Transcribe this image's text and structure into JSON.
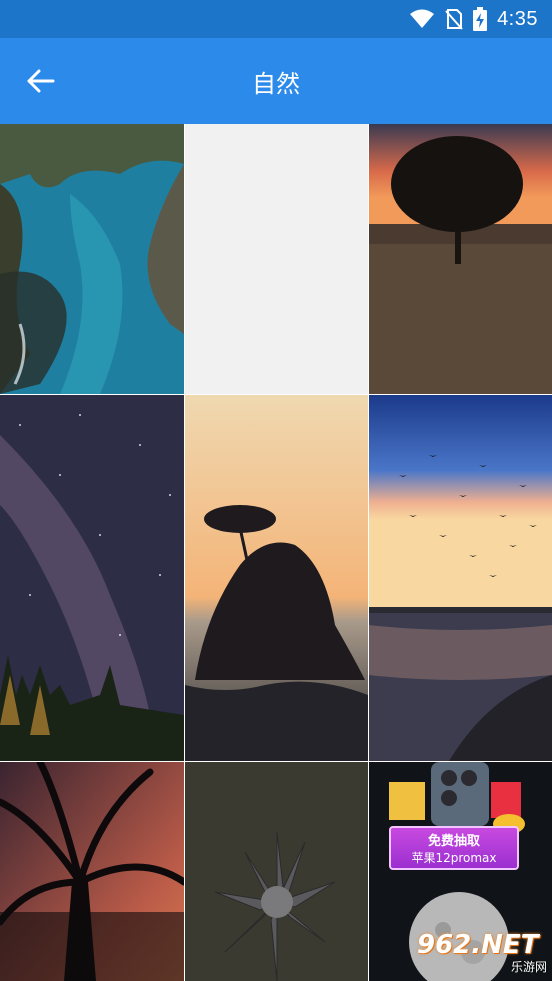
{
  "status_bar": {
    "time": "4:35",
    "icons": [
      "wifi-icon",
      "no-sim-icon",
      "battery-charging-icon"
    ]
  },
  "app_bar": {
    "title": "自然",
    "back_icon": "arrow-left-icon"
  },
  "wallpapers": [
    {
      "id": 1,
      "subject": "turquoise-river-canyon"
    },
    {
      "id": 2,
      "subject": "loading-placeholder"
    },
    {
      "id": 3,
      "subject": "tree-at-sunset"
    },
    {
      "id": 4,
      "subject": "milky-way-forest"
    },
    {
      "id": 5,
      "subject": "rock-island-tree-sunset"
    },
    {
      "id": 6,
      "subject": "birds-over-lake-sunrise"
    },
    {
      "id": 7,
      "subject": "palm-tree-silhouette"
    },
    {
      "id": 8,
      "subject": "succulent-plant"
    },
    {
      "id": 9,
      "subject": "ad-banner-moon"
    }
  ],
  "ad": {
    "line1": "免费抽取",
    "line2": "苹果12promax"
  },
  "watermark": {
    "brand": "962.NET",
    "site": "乐游网"
  }
}
